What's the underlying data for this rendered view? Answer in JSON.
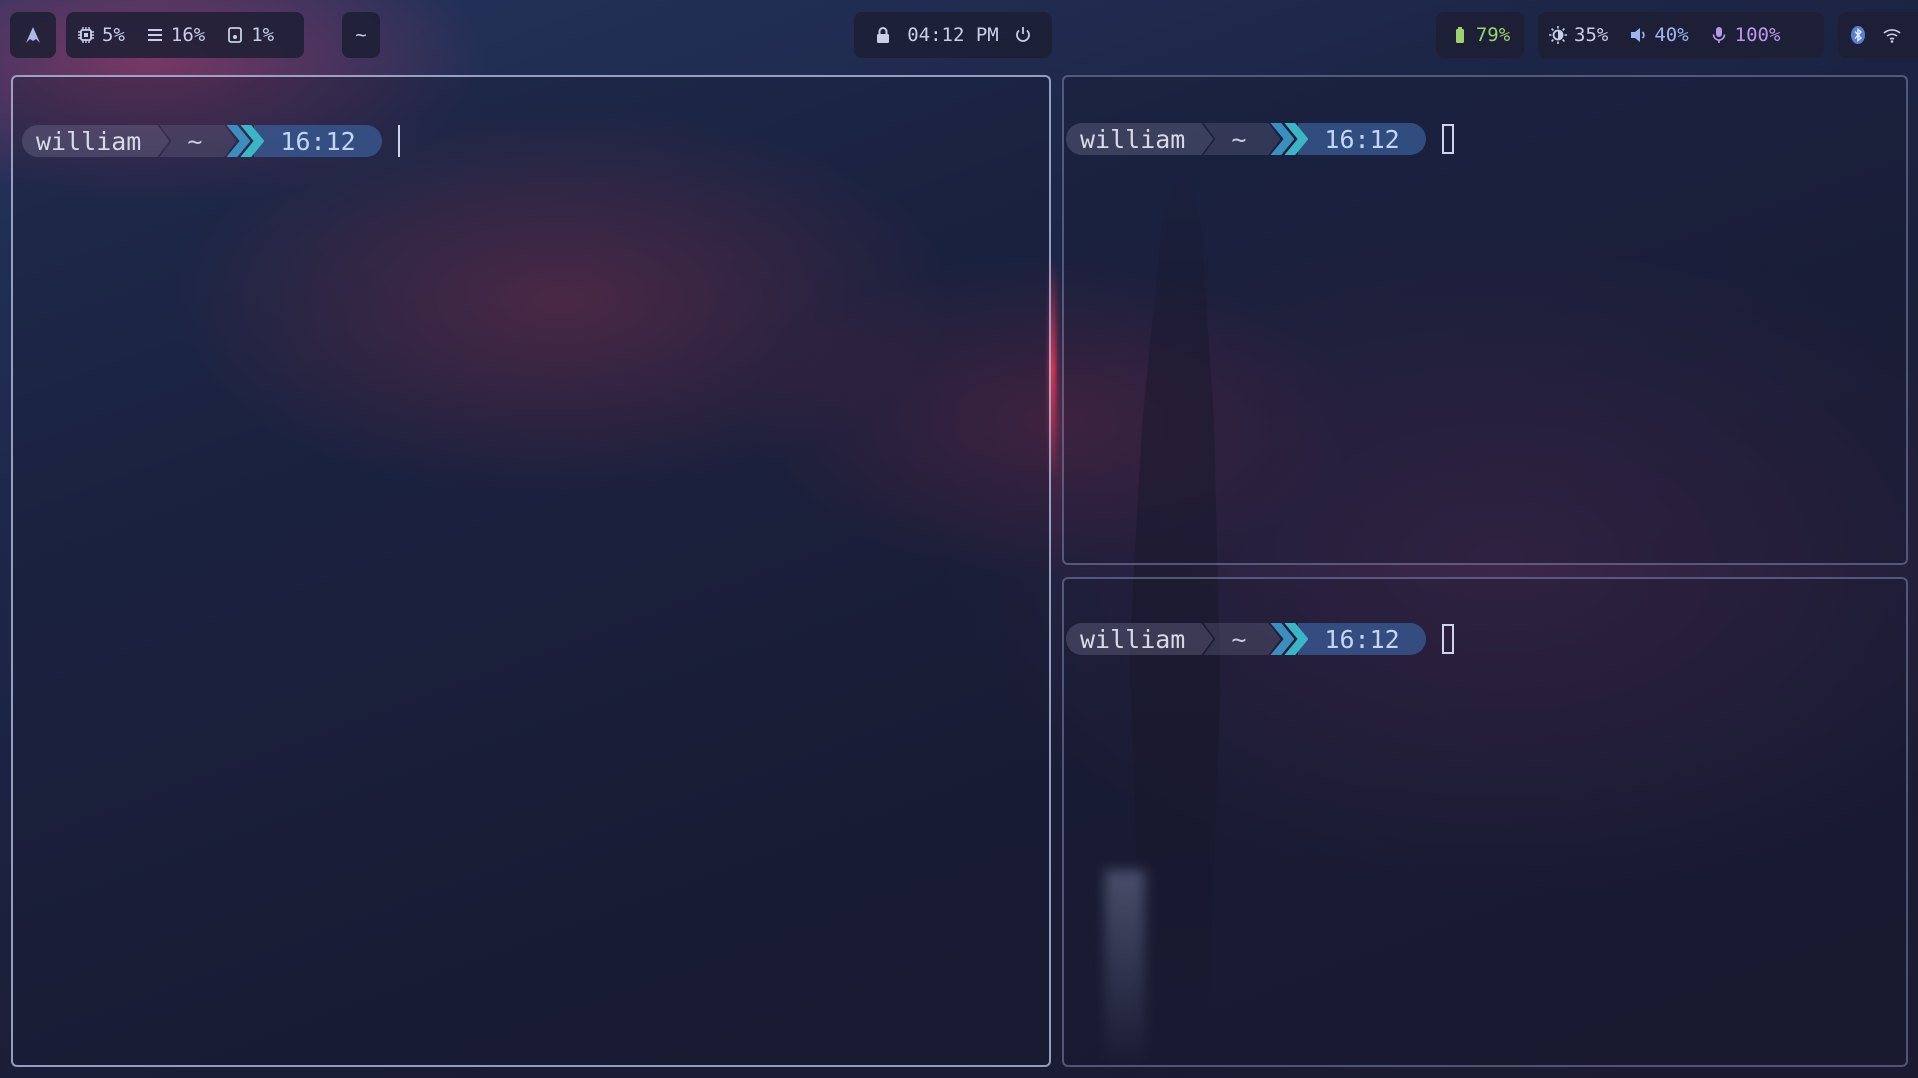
{
  "topbar": {
    "launcher_icon": "arch-logo-icon",
    "system": {
      "cpu": {
        "icon": "cpu-icon",
        "value": "5%"
      },
      "memory": {
        "icon": "memory-icon",
        "value": "16%"
      },
      "disk": {
        "icon": "disk-icon",
        "value": "1%"
      }
    },
    "workspace_label": "~",
    "clock": {
      "lock_icon": "lock-icon",
      "time": "04:12 PM",
      "power_icon": "power-icon"
    },
    "battery": {
      "icon": "battery-icon",
      "value": "79%"
    },
    "controls": {
      "brightness": {
        "icon": "brightness-icon",
        "value": "35%"
      },
      "volume": {
        "icon": "volume-icon",
        "value": "40%"
      },
      "microphone": {
        "icon": "microphone-icon",
        "value": "100%"
      }
    },
    "tray": {
      "bluetooth_icon": "bluetooth-icon",
      "wifi_icon": "wifi-icon"
    }
  },
  "terminals": [
    {
      "user": "william",
      "dir": "~",
      "time": "16:12"
    },
    {
      "user": "william",
      "dir": "~",
      "time": "16:12"
    },
    {
      "user": "william",
      "dir": "~",
      "time": "16:12"
    }
  ],
  "colors": {
    "battery_accent": "#9bd36e",
    "brightness_accent": "#9cb7f0",
    "mic_accent": "#b89be8",
    "prompt_time_bg": "#3a5c96",
    "prompt_arrow_1": "#3b8fbf",
    "prompt_arrow_2": "#3bb6c6"
  }
}
